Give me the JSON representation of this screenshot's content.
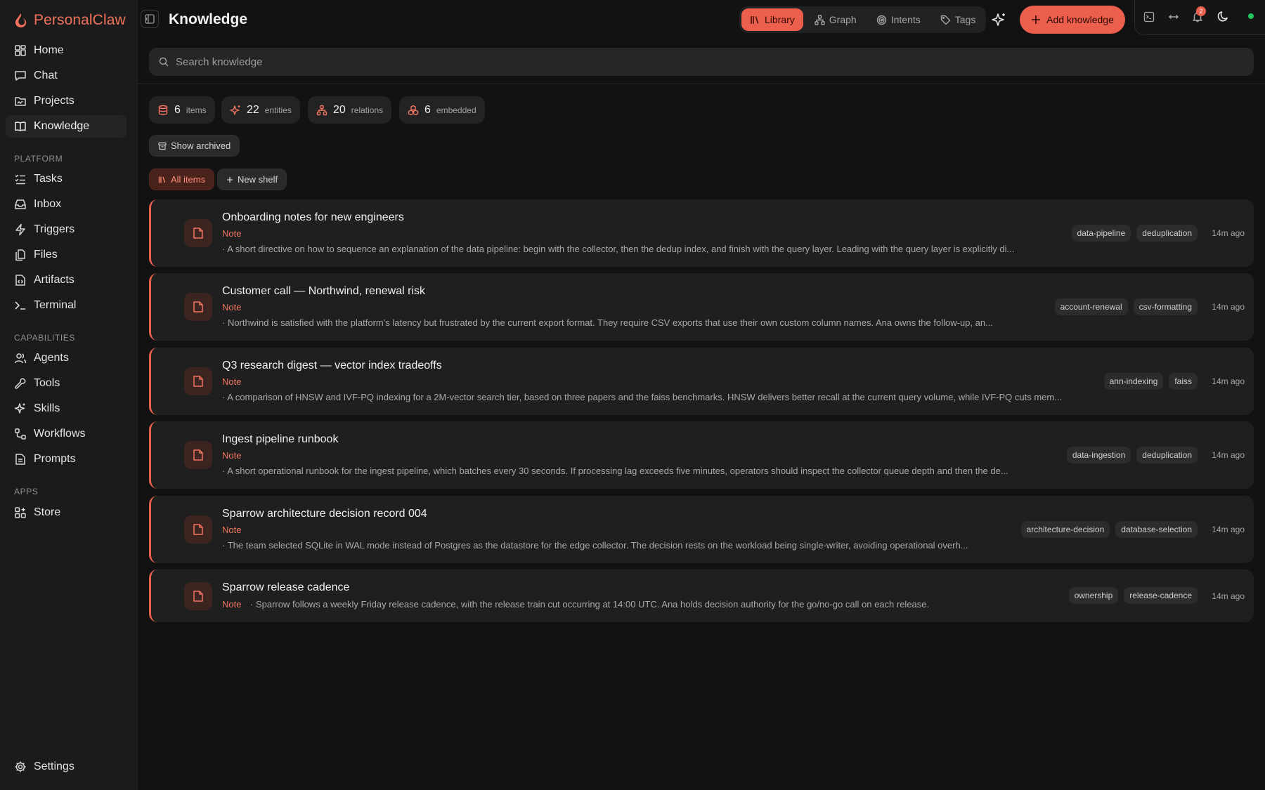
{
  "brand": {
    "name": "PersonalClaw"
  },
  "nav": {
    "main": [
      {
        "label": "Home",
        "icon": "home-icon"
      },
      {
        "label": "Chat",
        "icon": "chat-icon"
      },
      {
        "label": "Projects",
        "icon": "folder-icon"
      },
      {
        "label": "Knowledge",
        "icon": "book-icon",
        "active": true
      }
    ],
    "platform_title": "PLATFORM",
    "platform": [
      {
        "label": "Tasks"
      },
      {
        "label": "Inbox"
      },
      {
        "label": "Triggers"
      },
      {
        "label": "Files"
      },
      {
        "label": "Artifacts"
      },
      {
        "label": "Terminal"
      }
    ],
    "capabilities_title": "CAPABILITIES",
    "capabilities": [
      {
        "label": "Agents"
      },
      {
        "label": "Tools"
      },
      {
        "label": "Skills"
      },
      {
        "label": "Workflows"
      },
      {
        "label": "Prompts"
      }
    ],
    "apps_title": "APPS",
    "apps": [
      {
        "label": "Store"
      }
    ],
    "settings": "Settings"
  },
  "header": {
    "title": "Knowledge",
    "tabs": [
      {
        "label": "Library",
        "active": true
      },
      {
        "label": "Graph"
      },
      {
        "label": "Intents"
      },
      {
        "label": "Tags"
      }
    ],
    "add_label": "Add knowledge",
    "notification_count": "2"
  },
  "search": {
    "placeholder": "Search knowledge"
  },
  "stats": [
    {
      "value": "6",
      "label": "items"
    },
    {
      "value": "22",
      "label": "entities"
    },
    {
      "value": "20",
      "label": "relations"
    },
    {
      "value": "6",
      "label": "embedded"
    }
  ],
  "show_archived": "Show archived",
  "shelves": {
    "all_items": "All items",
    "new_shelf": "New shelf"
  },
  "items": [
    {
      "title": "Onboarding notes for new engineers",
      "type": "Note",
      "summary": "· A short directive on how to sequence an explanation of the data pipeline: begin with the collector, then the dedup index, and finish with the query layer. Leading with the query layer is explicitly di...",
      "tags": [
        "data-pipeline",
        "deduplication"
      ],
      "time": "14m ago"
    },
    {
      "title": "Customer call — Northwind, renewal risk",
      "type": "Note",
      "summary": "· Northwind is satisfied with the platform's latency but frustrated by the current export format. They require CSV exports that use their own custom column names. Ana owns the follow-up, an...",
      "tags": [
        "account-renewal",
        "csv-formatting"
      ],
      "time": "14m ago"
    },
    {
      "title": "Q3 research digest — vector index tradeoffs",
      "type": "Note",
      "summary": "· A comparison of HNSW and IVF-PQ indexing for a 2M-vector search tier, based on three papers and the faiss benchmarks. HNSW delivers better recall at the current query volume, while IVF-PQ cuts mem...",
      "tags": [
        "ann-indexing",
        "faiss"
      ],
      "time": "14m ago"
    },
    {
      "title": "Ingest pipeline runbook",
      "type": "Note",
      "summary": "· A short operational runbook for the ingest pipeline, which batches every 30 seconds. If processing lag exceeds five minutes, operators should inspect the collector queue depth and then the de...",
      "tags": [
        "data-ingestion",
        "deduplication"
      ],
      "time": "14m ago"
    },
    {
      "title": "Sparrow architecture decision record 004",
      "type": "Note",
      "summary": "· The team selected SQLite in WAL mode instead of Postgres as the datastore for the edge collector. The decision rests on the workload being single-writer, avoiding operational overh...",
      "tags": [
        "architecture-decision",
        "database-selection"
      ],
      "time": "14m ago"
    },
    {
      "title": "Sparrow release cadence",
      "type": "Note",
      "summary": "· Sparrow follows a weekly Friday release cadence, with the release train cut occurring at 14:00 UTC. Ana holds decision authority for the go/no-go call on each release.",
      "tags": [
        "ownership",
        "release-cadence"
      ],
      "time": "14m ago"
    }
  ],
  "colors": {
    "accent": "#ec5f4c",
    "background": "#121212",
    "sidebar": "#1b1b1b",
    "card": "#1f1f1f"
  }
}
